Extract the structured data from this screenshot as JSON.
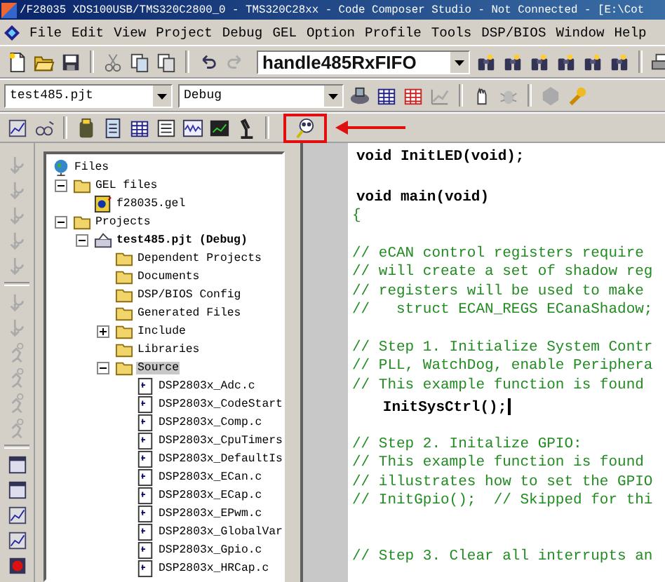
{
  "window": {
    "title": "/F28035 XDS100USB/TMS320C2800_0 - TMS320C28xx - Code Composer Studio - Not Connected - [E:\\Cot"
  },
  "menu": [
    {
      "label": "File"
    },
    {
      "label": "Edit"
    },
    {
      "label": "View"
    },
    {
      "label": "Project"
    },
    {
      "label": "Debug"
    },
    {
      "label": "GEL"
    },
    {
      "label": "Option"
    },
    {
      "label": "Profile"
    },
    {
      "label": "Tools"
    },
    {
      "label": "DSP/BIOS"
    },
    {
      "label": "Window"
    },
    {
      "label": "Help"
    }
  ],
  "toolbar": {
    "function_combo": "handle485RxFIFO",
    "project_combo": "test485.pjt",
    "config_combo": "Debug"
  },
  "tree": [
    {
      "label": "Files",
      "kind": "globe",
      "selected": false,
      "children": [
        {
          "label": "GEL files",
          "kind": "folder",
          "expanded": true,
          "selected": false,
          "children": [
            {
              "label": "f28035.gel",
              "kind": "gel",
              "selected": false
            }
          ]
        },
        {
          "label": "Projects",
          "kind": "folder",
          "expanded": true,
          "selected": false,
          "children": [
            {
              "label": "test485.pjt (Debug)",
              "kind": "project",
              "expanded": true,
              "selected": false,
              "children": [
                {
                  "label": "Dependent Projects",
                  "kind": "folder",
                  "selected": false
                },
                {
                  "label": "Documents",
                  "kind": "folder",
                  "selected": false
                },
                {
                  "label": "DSP/BIOS Config",
                  "kind": "folder",
                  "selected": false
                },
                {
                  "label": "Generated Files",
                  "kind": "folder",
                  "selected": false
                },
                {
                  "label": "Include",
                  "kind": "folder",
                  "expanded": false,
                  "selected": false
                },
                {
                  "label": "Libraries",
                  "kind": "folder",
                  "selected": false
                },
                {
                  "label": "Source",
                  "kind": "folder",
                  "expanded": true,
                  "selected": true,
                  "children": [
                    {
                      "label": "DSP2803x_Adc.c",
                      "kind": "file",
                      "selected": false
                    },
                    {
                      "label": "DSP2803x_CodeStart",
                      "kind": "file",
                      "selected": false
                    },
                    {
                      "label": "DSP2803x_Comp.c",
                      "kind": "file",
                      "selected": false
                    },
                    {
                      "label": "DSP2803x_CpuTimers",
                      "kind": "file",
                      "selected": false
                    },
                    {
                      "label": "DSP2803x_DefaultIs",
                      "kind": "file",
                      "selected": false
                    },
                    {
                      "label": "DSP2803x_ECan.c",
                      "kind": "file",
                      "selected": false
                    },
                    {
                      "label": "DSP2803x_ECap.c",
                      "kind": "file",
                      "selected": false
                    },
                    {
                      "label": "DSP2803x_EPwm.c",
                      "kind": "file",
                      "selected": false
                    },
                    {
                      "label": "DSP2803x_GlobalVar",
                      "kind": "file",
                      "selected": false
                    },
                    {
                      "label": "DSP2803x_Gpio.c",
                      "kind": "file",
                      "selected": false
                    },
                    {
                      "label": "DSP2803x_HRCap.c",
                      "kind": "file",
                      "selected": false
                    }
                  ]
                }
              ]
            }
          ]
        }
      ]
    }
  ],
  "editor": {
    "lines": [
      {
        "kind": "code",
        "text": "void InitLED(void);",
        "cursor": false
      },
      {
        "kind": "blank"
      },
      {
        "kind": "code",
        "text": "void main(void)",
        "cursor": false
      },
      {
        "kind": "plain",
        "text": "{",
        "cursor": false
      },
      {
        "kind": "blank"
      },
      {
        "kind": "comment",
        "text": "// eCAN control registers require",
        "cursor": false
      },
      {
        "kind": "comment",
        "text": "// will create a set of shadow reg",
        "cursor": false
      },
      {
        "kind": "comment",
        "text": "// registers will be used to make",
        "cursor": false
      },
      {
        "kind": "comment",
        "text": "//   struct ECAN_REGS ECanaShadow;",
        "cursor": false
      },
      {
        "kind": "blank"
      },
      {
        "kind": "comment",
        "text": "// Step 1. Initialize System Contr",
        "cursor": false
      },
      {
        "kind": "comment",
        "text": "// PLL, WatchDog, enable Periphera",
        "cursor": false
      },
      {
        "kind": "comment",
        "text": "// This example function is found",
        "cursor": false
      },
      {
        "kind": "code",
        "text": "   InitSysCtrl();",
        "cursor": true
      },
      {
        "kind": "blank"
      },
      {
        "kind": "comment",
        "text": "// Step 2. Initalize GPIO:",
        "cursor": false
      },
      {
        "kind": "comment",
        "text": "// This example function is found",
        "cursor": false
      },
      {
        "kind": "comment",
        "text": "// illustrates how to set the GPIO",
        "cursor": false
      },
      {
        "kind": "comment",
        "text": "// InitGpio();  // Skipped for thi",
        "cursor": false
      },
      {
        "kind": "blank"
      },
      {
        "kind": "blank"
      },
      {
        "kind": "comment",
        "text": "// Step 3. Clear all interrupts an",
        "cursor": false
      }
    ]
  }
}
